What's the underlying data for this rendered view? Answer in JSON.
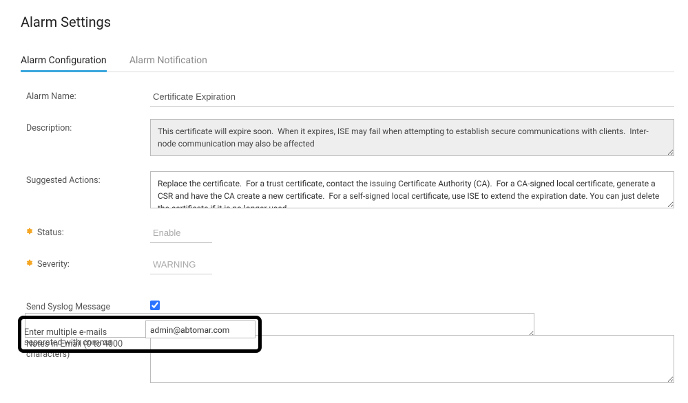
{
  "page": {
    "title": "Alarm Settings"
  },
  "tabs": {
    "configuration": "Alarm Configuration",
    "notification": "Alarm Notification"
  },
  "labels": {
    "alarm_name": "Alarm Name:",
    "description": "Description:",
    "suggested_actions": "Suggested Actions:",
    "status": "Status:",
    "severity": "Severity:",
    "syslog": "Send Syslog Message",
    "emails": "Enter multiple e-mails separated with comma",
    "notes": "Notes in Email (0 to 4000 characters)"
  },
  "values": {
    "alarm_name": "Certificate Expiration",
    "description": "This certificate will expire soon.  When it expires, ISE may fail when attempting to establish secure communications with clients.  Inter-node communication may also be affected",
    "suggested_actions": "Replace the certificate.  For a trust certificate, contact the issuing Certificate Authority (CA).  For a CA-signed local certificate, generate a CSR and have the CA create a new certificate.  For a self-signed local certificate, use ISE to extend the expiration date. You can just delete the certificate if it is no longer used",
    "status": "Enable",
    "severity": "WARNING",
    "syslog_checked": true,
    "emails": "admin@abtomar.com",
    "notes": ""
  }
}
